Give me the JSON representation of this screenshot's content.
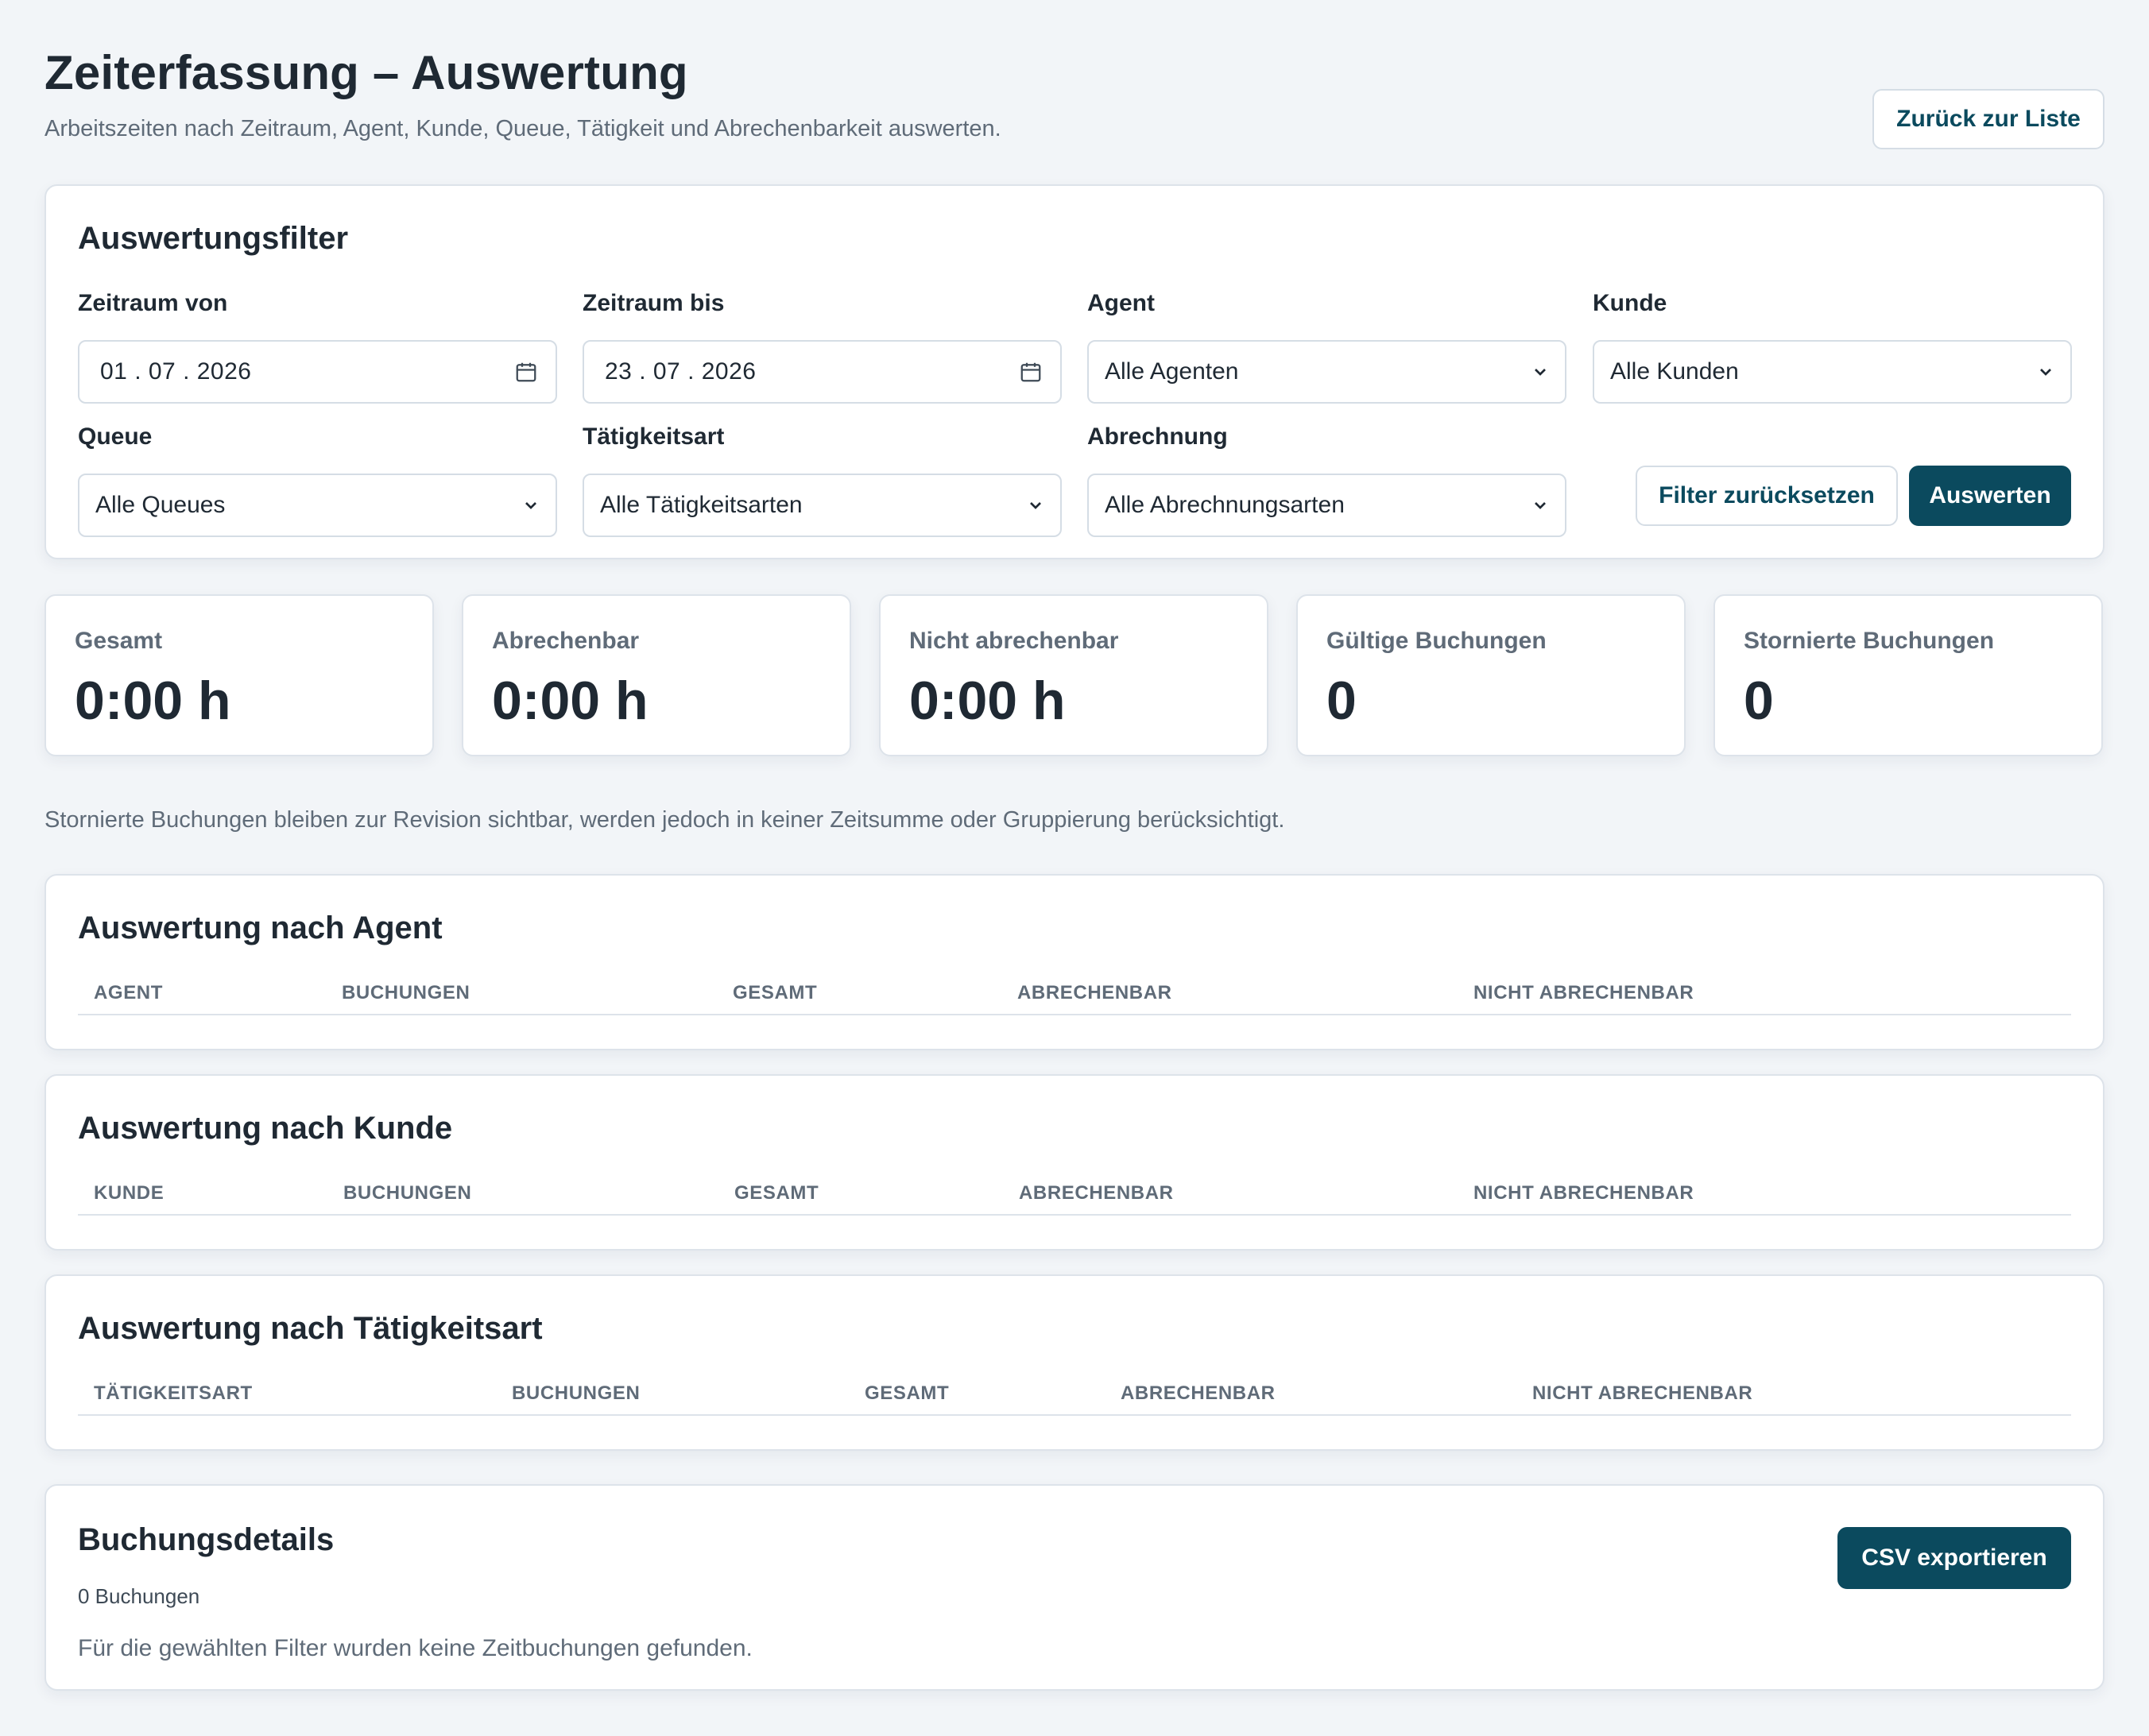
{
  "header": {
    "title": "Zeiterfassung – Auswertung",
    "subtitle": "Arbeitszeiten nach Zeitraum, Agent, Kunde, Queue, Tätigkeit und Abrechenbarkeit auswerten.",
    "back_label": "Zurück zur Liste"
  },
  "filters": {
    "title": "Auswertungsfilter",
    "from_label": "Zeitraum von",
    "from_value": "01 . 07 . 2026",
    "to_label": "Zeitraum bis",
    "to_value": "23 . 07 . 2026",
    "agent_label": "Agent",
    "agent_value": "Alle Agenten",
    "customer_label": "Kunde",
    "customer_value": "Alle Kunden",
    "queue_label": "Queue",
    "queue_value": "Alle Queues",
    "activity_label": "Tätigkeitsart",
    "activity_value": "Alle Tätigkeitsarten",
    "billing_label": "Abrechnung",
    "billing_value": "Alle Abrechnungsarten",
    "reset_label": "Filter zurücksetzen",
    "submit_label": "Auswerten"
  },
  "stats": [
    {
      "label": "Gesamt",
      "value": "0:00 h"
    },
    {
      "label": "Abrechenbar",
      "value": "0:00 h"
    },
    {
      "label": "Nicht abrechenbar",
      "value": "0:00 h"
    },
    {
      "label": "Gültige Buchungen",
      "value": "0"
    },
    {
      "label": "Stornierte Buchungen",
      "value": "0"
    }
  ],
  "note": "Stornierte Buchungen bleiben zur Revision sichtbar, werden jedoch in keiner Zeitsumme oder Gruppierung berücksichtigt.",
  "by_agent": {
    "title": "Auswertung nach Agent",
    "columns": [
      "AGENT",
      "BUCHUNGEN",
      "GESAMT",
      "ABRECHENBAR",
      "NICHT ABRECHENBAR"
    ]
  },
  "by_customer": {
    "title": "Auswertung nach Kunde",
    "columns": [
      "KUNDE",
      "BUCHUNGEN",
      "GESAMT",
      "ABRECHENBAR",
      "NICHT ABRECHENBAR"
    ]
  },
  "by_activity": {
    "title": "Auswertung nach Tätigkeitsart",
    "columns": [
      "TÄTIGKEITSART",
      "BUCHUNGEN",
      "GESAMT",
      "ABRECHENBAR",
      "NICHT ABRECHENBAR"
    ]
  },
  "details": {
    "title": "Buchungsdetails",
    "count": "0 Buchungen",
    "empty": "Für die gewählten Filter wurden keine Zeitbuchungen gefunden.",
    "export_label": "CSV exportieren"
  },
  "colors": {
    "accent": "#0b4a5e",
    "background": "#f2f5f8",
    "card": "#ffffff",
    "border": "#dde3ea",
    "muted_text": "#5f6b78"
  }
}
